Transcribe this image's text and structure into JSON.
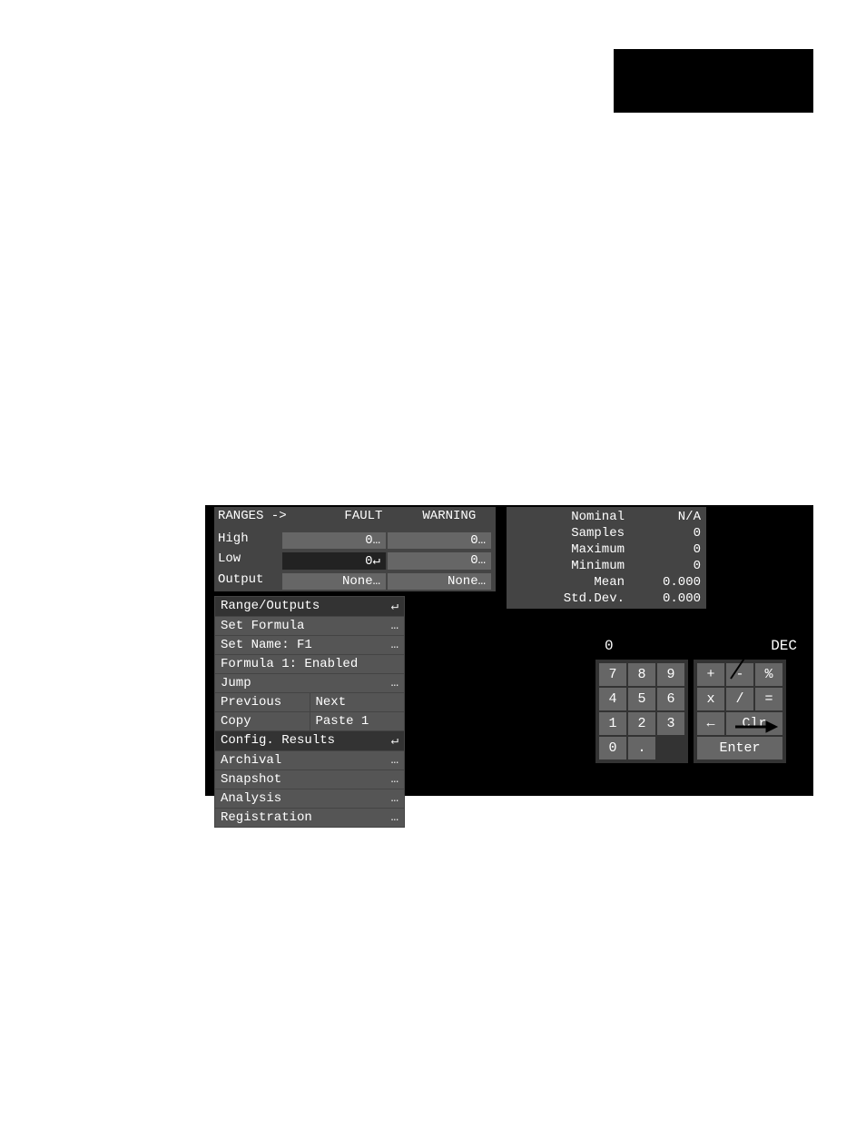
{
  "ranges": {
    "title": "RANGES ->",
    "col_fault": "FAULT",
    "col_warning": "WARNING",
    "rows": [
      {
        "label": "High",
        "fault": "0…",
        "warning": "0…"
      },
      {
        "label": "Low",
        "fault": "0↵",
        "warning": "0…"
      },
      {
        "label": "Output",
        "fault": "None…",
        "warning": "None…"
      }
    ]
  },
  "menu": {
    "range_outputs": "Range/Outputs",
    "set_formula": "Set Formula",
    "set_name": "Set Name: F1",
    "formula1": "Formula 1: Enabled",
    "jump": "Jump",
    "previous": "Previous",
    "next": "Next",
    "copy": "Copy",
    "paste": "Paste 1",
    "config_results": "Config. Results",
    "archival": "Archival",
    "snapshot": "Snapshot",
    "analysis": "Analysis",
    "registration": "Registration",
    "glyph_enter": "↵",
    "glyph_more": "…"
  },
  "stats": {
    "nominal": {
      "k": "Nominal",
      "v": "N/A"
    },
    "samples": {
      "k": "Samples",
      "v": "0"
    },
    "maximum": {
      "k": "Maximum",
      "v": "0"
    },
    "minimum": {
      "k": "Minimum",
      "v": "0"
    },
    "mean": {
      "k": "Mean",
      "v": "0.000"
    },
    "stddev": {
      "k": "Std.Dev.",
      "v": "0.000"
    }
  },
  "calc": {
    "display_value": "0",
    "display_mode": "DEC",
    "keys_num": [
      "7",
      "8",
      "9",
      "4",
      "5",
      "6",
      "1",
      "2",
      "3",
      "0",
      "."
    ],
    "keys_op": {
      "plus": "+",
      "minus": "-",
      "pct": "%",
      "mul": "x",
      "div": "/",
      "eq": "=",
      "back": "←",
      "clr": "Clr",
      "enter": "Enter"
    }
  }
}
